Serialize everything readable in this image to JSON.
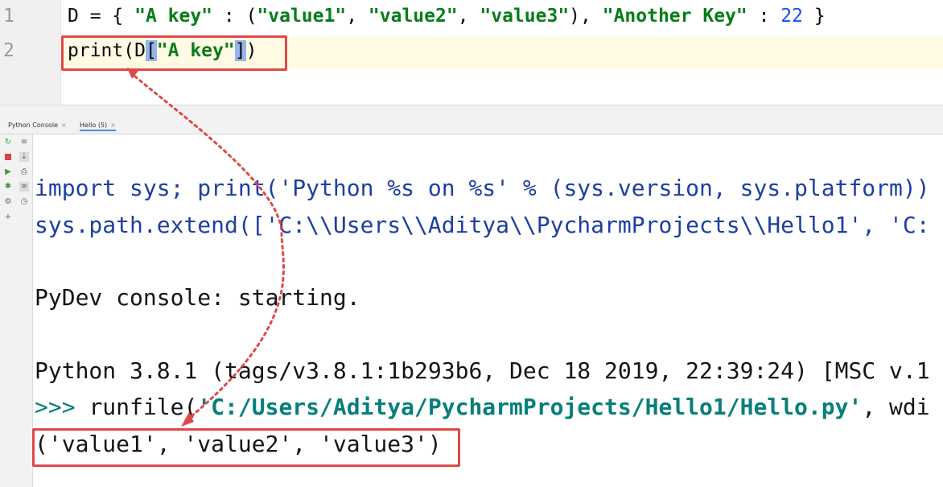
{
  "editor": {
    "line_numbers": [
      "1",
      "2"
    ],
    "line1": {
      "p1": "D = { ",
      "s1": "\"A key\"",
      "p2": " : (",
      "s2": "\"value1\"",
      "p3": ", ",
      "s3": "\"value2\"",
      "p4": ", ",
      "s4": "\"value3\"",
      "p5": "), ",
      "s5": "\"Another Key\"",
      "p6": " : ",
      "n1": "22",
      "p7": " }"
    },
    "line2": {
      "p1": "print(D",
      "b1": "[",
      "s1": "\"A key\"",
      "b2": "]",
      "p2": ")"
    }
  },
  "console": {
    "tabs": [
      {
        "label": "Python Console",
        "close": "×"
      },
      {
        "label": "Hello (5)",
        "close": "×"
      }
    ],
    "lines": {
      "l1": "import sys; print('Python %s on %s' % (sys.version, sys.platform))",
      "l2": "sys.path.extend(['C:\\\\Users\\\\Aditya\\\\PycharmProjects\\\\Hello1', 'C:",
      "l3": "PyDev console: starting.",
      "l4": "Python 3.8.1 (tags/v3.8.1:1b293b6, Dec 18 2019, 22:39:24) [MSC v.1",
      "l5_prompt": ">>> ",
      "l5_cmd": "runfile(",
      "l5_path": "'C:/Users/Aditya/PycharmProjects/Hello1/Hello.py'",
      "l5_rest": ", wdi",
      "l6": "('value1', 'value2', 'value3')"
    }
  },
  "colors": {
    "highlight_box": "#e04848",
    "string": "#067d17",
    "number": "#1750eb",
    "console_text": "#1d3fa3"
  }
}
